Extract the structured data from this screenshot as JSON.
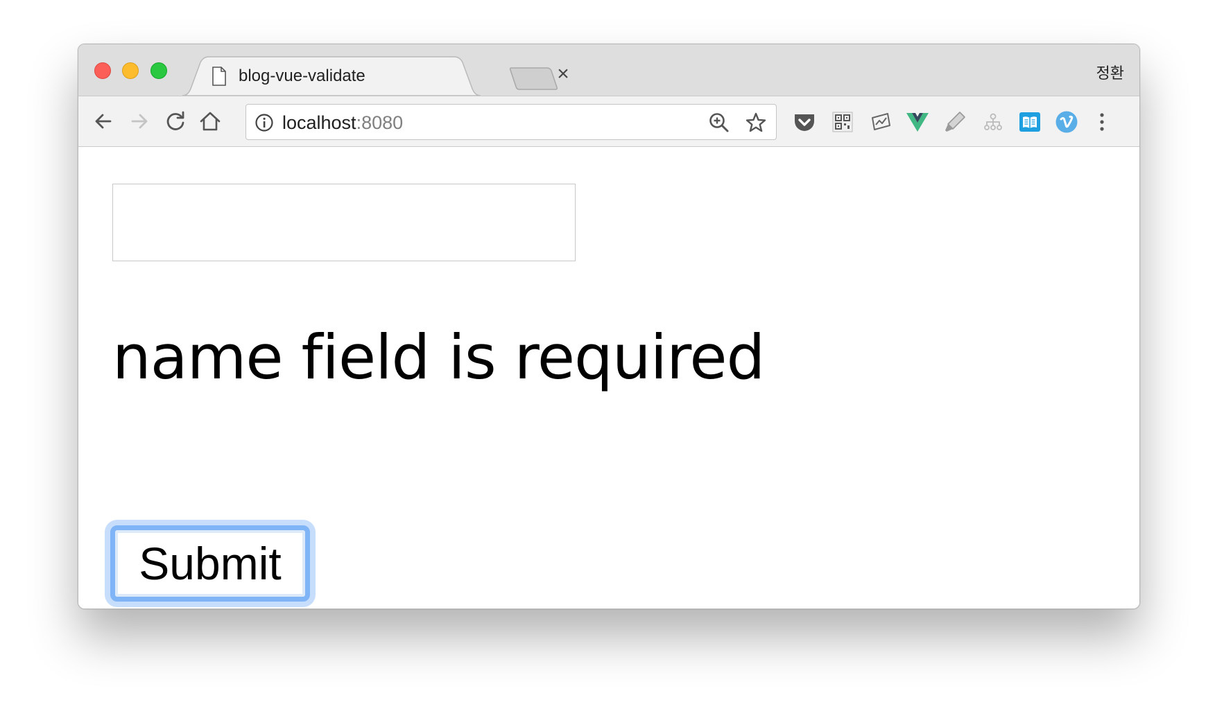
{
  "window": {
    "profile_name": "정환"
  },
  "tabs": [
    {
      "title": "blog-vue-validate",
      "close_symbol": "×"
    }
  ],
  "toolbar": {
    "back_icon": "arrow-left-icon",
    "forward_icon": "arrow-right-icon",
    "reload_icon": "reload-icon",
    "home_icon": "home-icon",
    "address": {
      "host": "localhost",
      "port": ":8080",
      "info_icon": "info-icon",
      "zoom_icon": "zoom-in-icon",
      "bookmark_icon": "star-icon"
    },
    "extensions": [
      {
        "name": "pocket-icon",
        "color": "#555555"
      },
      {
        "name": "qr-code-icon",
        "color": "#555555"
      },
      {
        "name": "chart-icon",
        "color": "#666666"
      },
      {
        "name": "vue-devtools-icon",
        "color": "#41b883"
      },
      {
        "name": "marker-icon",
        "color": "#999999"
      },
      {
        "name": "sitemap-icon",
        "color": "#bbbbbb"
      },
      {
        "name": "reader-icon",
        "color": "#1ea0e0"
      },
      {
        "name": "vimeo-icon",
        "color": "#5aaee8"
      }
    ],
    "menu_icon": "kebab-menu-icon"
  },
  "page": {
    "name_input": {
      "value": "",
      "placeholder": ""
    },
    "error_message": "name field is required",
    "submit_label": "Submit",
    "focus_ring_color": "#7fb5f6"
  }
}
